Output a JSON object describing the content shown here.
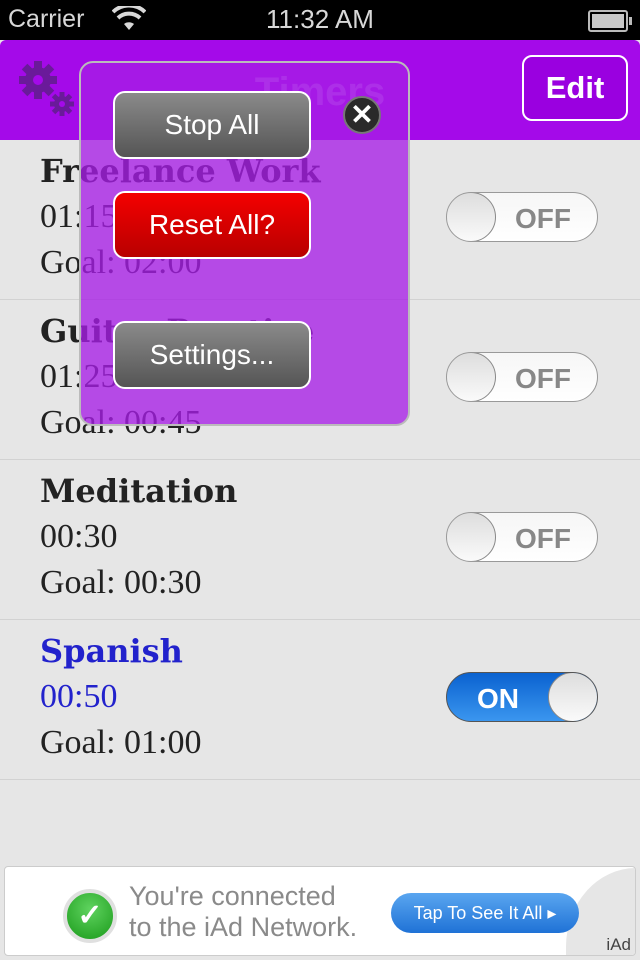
{
  "status_bar": {
    "carrier": "Carrier",
    "time": "11:32 AM",
    "wifi_icon": "wifi-icon",
    "battery_icon": "battery-icon"
  },
  "navbar": {
    "title": "Timers",
    "settings_icon": "gears-icon",
    "edit_label": "Edit",
    "color": "#a40ae9"
  },
  "timers": [
    {
      "name": "Freelance Work",
      "elapsed": "01:15",
      "goal": "Goal: 02:00",
      "state": "OFF"
    },
    {
      "name": "Guitar Practice",
      "elapsed": "01:25",
      "goal": "Goal: 00:45",
      "state": "OFF"
    },
    {
      "name": "Meditation",
      "elapsed": "00:30",
      "goal": "Goal: 00:30",
      "state": "OFF"
    },
    {
      "name": "Spanish",
      "elapsed": "00:50",
      "goal": "Goal: 01:00",
      "state": "ON"
    }
  ],
  "popover": {
    "stop_all": "Stop All",
    "reset_all": "Reset All?",
    "settings": "Settings...",
    "close_icon": "close-icon",
    "close_glyph": "✕"
  },
  "ad": {
    "line1": "You're connected",
    "line2": "to the iAd Network.",
    "cta": "Tap To See It All ▸",
    "brand": "iAd"
  },
  "colors": {
    "active_text": "#2222cc",
    "toggle_on": "#1f72d6",
    "reset_red": "#e00000"
  }
}
